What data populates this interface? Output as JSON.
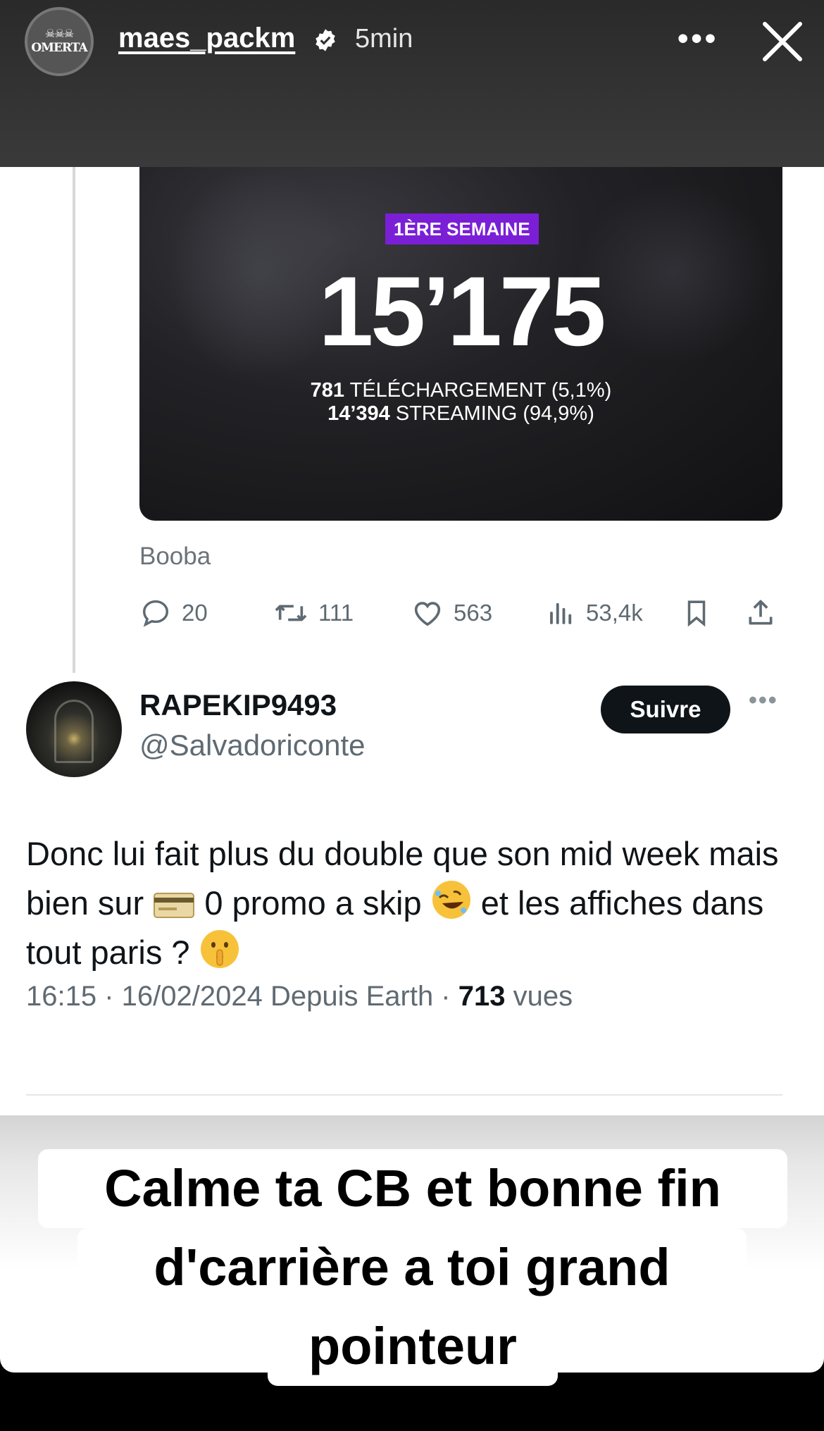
{
  "story": {
    "username": "maes_packm",
    "time": "5min",
    "avatar_brand": "OMERTA",
    "avatar_skulls": "☠☠☠"
  },
  "tweet": {
    "media": {
      "badge": "1ÈRE SEMAINE",
      "total": "15’175",
      "downloads_value": "781",
      "downloads_label": "TÉLÉCHARGEMENT (5,1%)",
      "streaming_value": "14’394",
      "streaming_label": "STREAMING (94,9%)"
    },
    "source": "Booba",
    "actions": {
      "replies": "20",
      "retweets": "111",
      "likes": "563",
      "views": "53,4k"
    }
  },
  "reply": {
    "name": "RAPEKIP9493",
    "handle": "@Salvadoriconte",
    "follow_label": "Suivre",
    "text_part1": "Donc lui fait plus du double que son mid week mais bien sur ",
    "text_part2": " 0 promo a skip ",
    "text_part3": " et les affiches dans tout paris ? ",
    "emoji_names": [
      "credit-card-emoji",
      "rolling-laughing-emoji",
      "shushing-face-emoji"
    ],
    "meta_prefix": "16:15 · 16/02/2024 Depuis Earth · ",
    "meta_views_count": "713",
    "meta_views_label": " vues"
  },
  "caption": {
    "line1": "Calme ta CB et bonne fin",
    "line2": "d'carrière a toi grand",
    "line3": "pointeur"
  },
  "colors": {
    "badge_purple": "#7b1fd6",
    "follow_button": "#0f1419",
    "secondary_text": "#5f6a72"
  }
}
